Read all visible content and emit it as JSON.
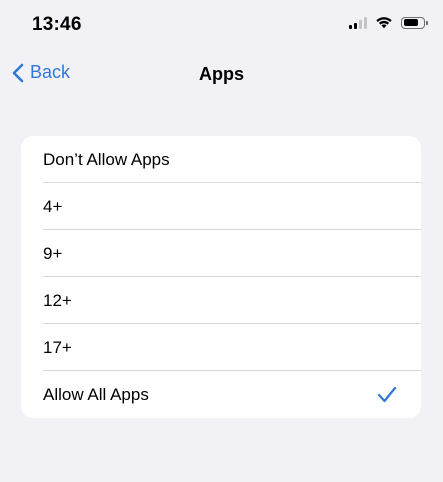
{
  "status_bar": {
    "time": "13:46",
    "icons": [
      "signal-icon",
      "wifi-icon",
      "battery-icon"
    ],
    "battery_level": 0.78
  },
  "nav": {
    "back_label": "Back",
    "title": "Apps"
  },
  "options": [
    {
      "label": "Don’t Allow Apps",
      "selected": false
    },
    {
      "label": "4+",
      "selected": false
    },
    {
      "label": "9+",
      "selected": false
    },
    {
      "label": "12+",
      "selected": false
    },
    {
      "label": "17+",
      "selected": false
    },
    {
      "label": "Allow All Apps",
      "selected": true
    }
  ],
  "colors": {
    "accent": "#2f78d8",
    "background": "#f2f1f6",
    "card": "#ffffff",
    "separator": "#d8d8dc"
  }
}
